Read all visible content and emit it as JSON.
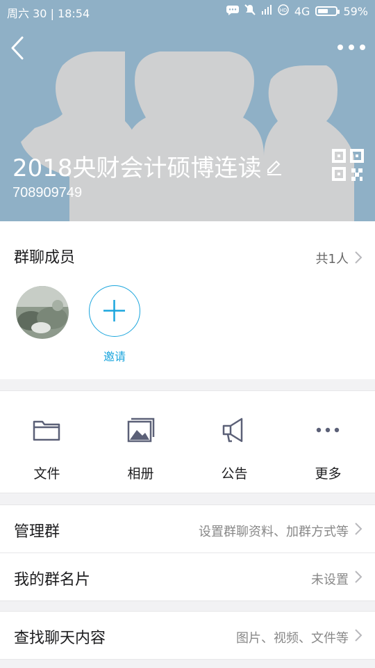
{
  "status_bar": {
    "day": "周六",
    "date": "30",
    "time": "18:54",
    "network": "4G",
    "battery": "59%",
    "battery_level": 0.59
  },
  "header": {
    "group_name": "2018央财会计硕博连读",
    "group_id": "708909749",
    "bg_color": "#8fb0c6"
  },
  "members": {
    "title": "群聊成员",
    "count": "共1人",
    "invite_label": "邀请",
    "accent": "#1aa5dd"
  },
  "tools": [
    {
      "label": "文件",
      "icon": "folder-icon"
    },
    {
      "label": "相册",
      "icon": "album-icon"
    },
    {
      "label": "公告",
      "icon": "megaphone-icon"
    },
    {
      "label": "更多",
      "icon": "more-icon"
    }
  ],
  "rows": {
    "manage": {
      "title": "管理群",
      "value": "设置群聊资料、加群方式等"
    },
    "card": {
      "title": "我的群名片",
      "value": "未设置"
    },
    "search": {
      "title": "查找聊天内容",
      "value": "图片、视频、文件等"
    }
  }
}
